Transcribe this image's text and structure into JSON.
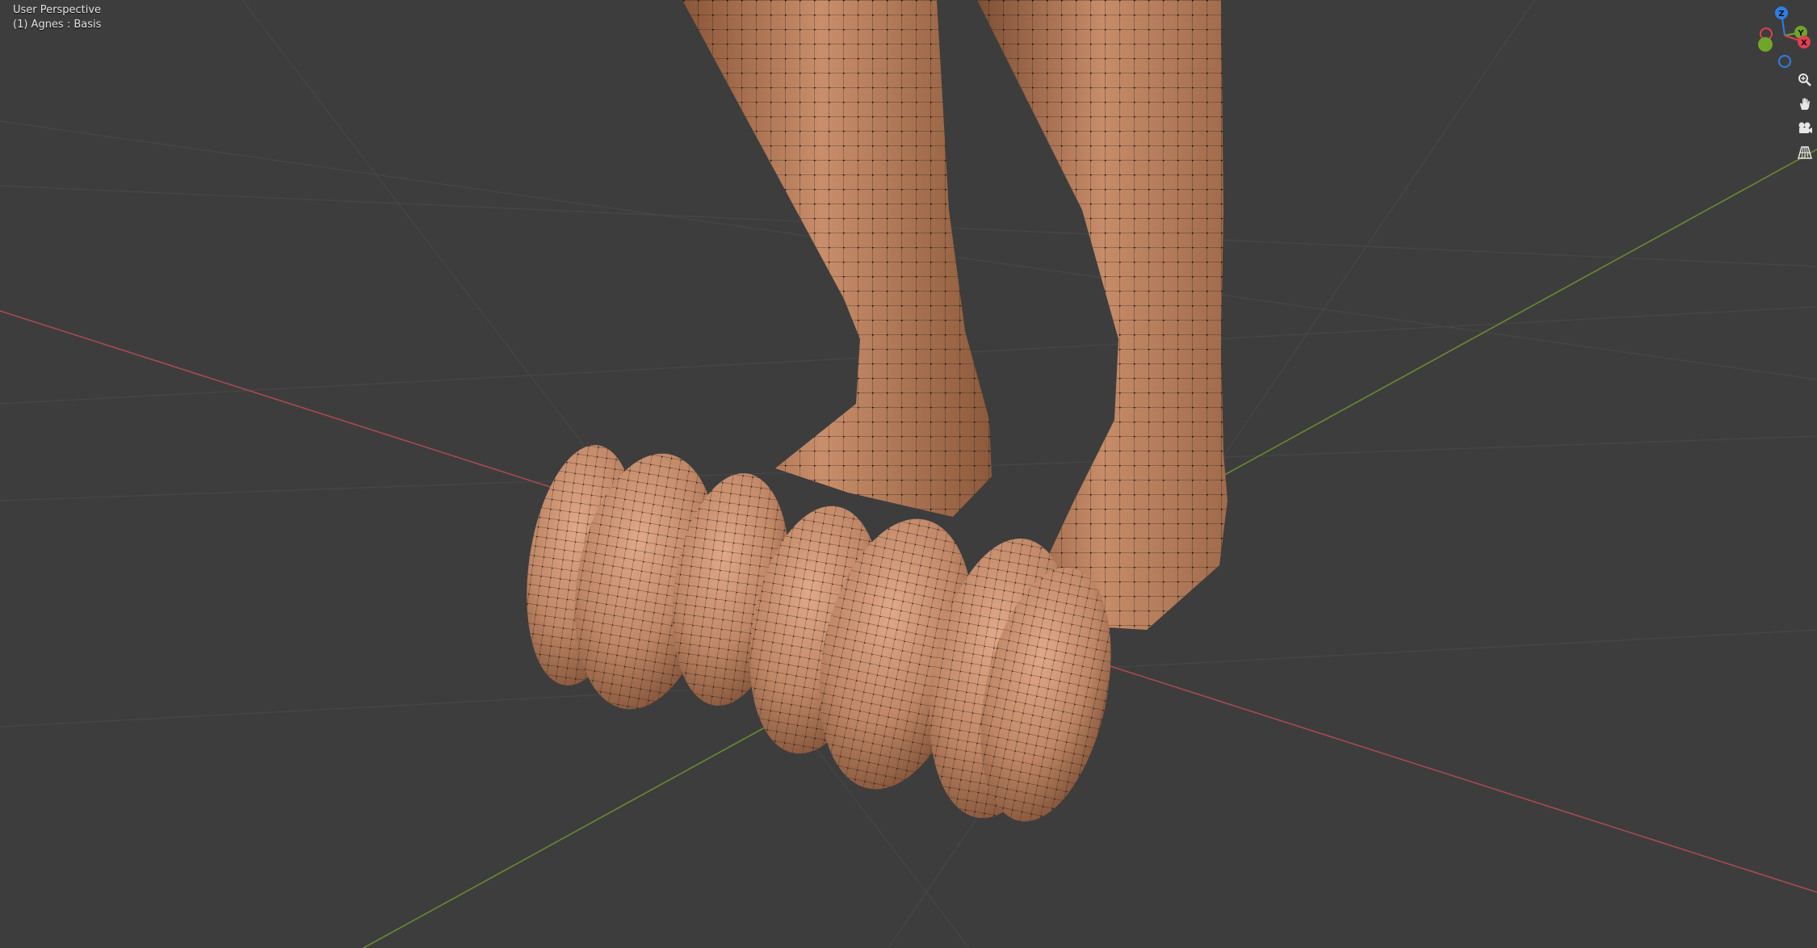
{
  "viewport": {
    "view_name": "User Perspective",
    "object_label": "(1) Agnes : Basis"
  },
  "gizmo": {
    "axes": [
      {
        "label": "Z",
        "color": "#2d7fe6"
      },
      {
        "label": "Y",
        "color": "#6fa52b"
      },
      {
        "label": "X",
        "color": "#e0404f"
      }
    ]
  },
  "nav_tools": [
    {
      "icon": "zoom-icon"
    },
    {
      "icon": "hand-pan-icon"
    },
    {
      "icon": "camera-icon"
    },
    {
      "icon": "grid-perspective-icon"
    }
  ],
  "colors": {
    "background": "#3d3d3d",
    "grid_line": "#4a4a4a",
    "x_axis": "#a84a52",
    "y_axis": "#6b8a2e",
    "mesh_skin": "#c08766",
    "mesh_shadow": "#7a4c33",
    "wire": "#1a1412"
  }
}
